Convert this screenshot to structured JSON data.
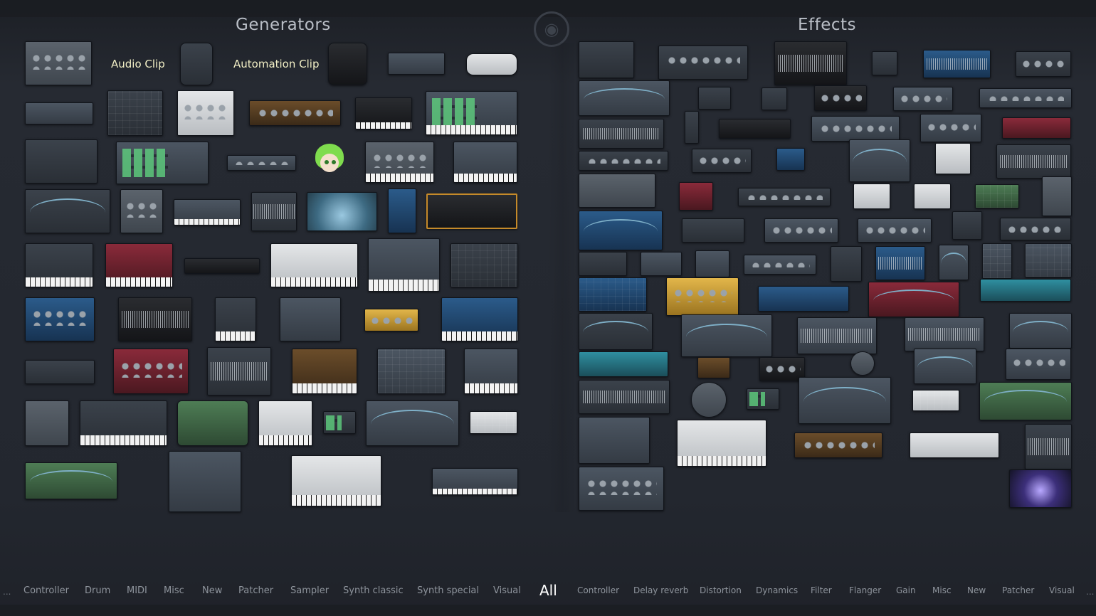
{
  "sections": {
    "generators_title": "Generators",
    "effects_title": "Effects"
  },
  "clips": {
    "audio_clip": "Audio Clip",
    "automation_clip": "Automation Clip"
  },
  "ghost_icon": "fl-studio-logo-icon",
  "categories": {
    "ellipsis_left": "...",
    "ellipsis_right": "...",
    "generators": [
      "Controller",
      "Drum",
      "MIDI",
      "Misc",
      "New",
      "Patcher",
      "Sampler",
      "Synth classic",
      "Synth special",
      "Visual"
    ],
    "all": "All",
    "effects": [
      "Controller",
      "Delay reverb",
      "Distortion",
      "Dynamics",
      "Filter",
      "Flanger",
      "Gain",
      "Misc",
      "New",
      "Patcher",
      "Visual"
    ]
  },
  "colors": {
    "background": "#23272f",
    "title_text": "#b9bec6",
    "clip_label": "#f2efc6",
    "category_text": "#8e949c",
    "selected_category": "#ffffff"
  }
}
